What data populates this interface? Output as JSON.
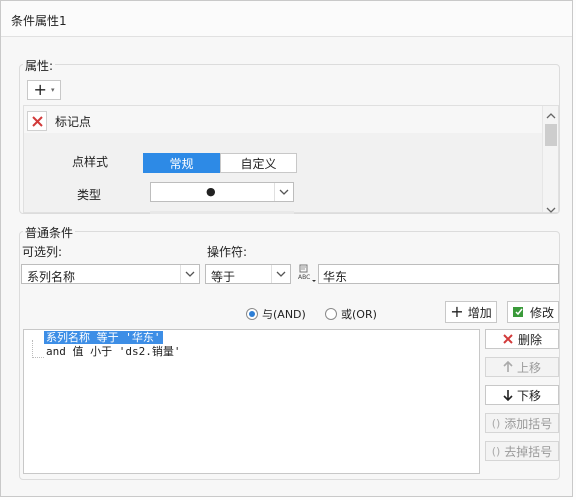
{
  "title": "条件属性1",
  "attributes_group": {
    "legend": "属性:",
    "marker_label": "标记点",
    "point_style_label": "点样式",
    "point_style_tabs": [
      "常规",
      "自定义"
    ],
    "type_label": "类型",
    "type_value": "●"
  },
  "condition_group": {
    "legend": "普通条件",
    "column_label": "可选列:",
    "column_value": "系列名称",
    "operator_label": "操作符:",
    "operator_value": "等于",
    "value_field": "华东",
    "logic_and": "与(AND)",
    "logic_or": "或(OR)",
    "logic_selected": "and",
    "add_label": "增加",
    "modify_label": "修改",
    "conditions": [
      "系列名称 等于 '华东'",
      "and 值 小于 'ds2.销量'"
    ],
    "buttons": {
      "delete": "删除",
      "move_up": "上移",
      "move_down": "下移",
      "add_bracket": "添加括号",
      "remove_bracket": "去掉括号"
    }
  }
}
